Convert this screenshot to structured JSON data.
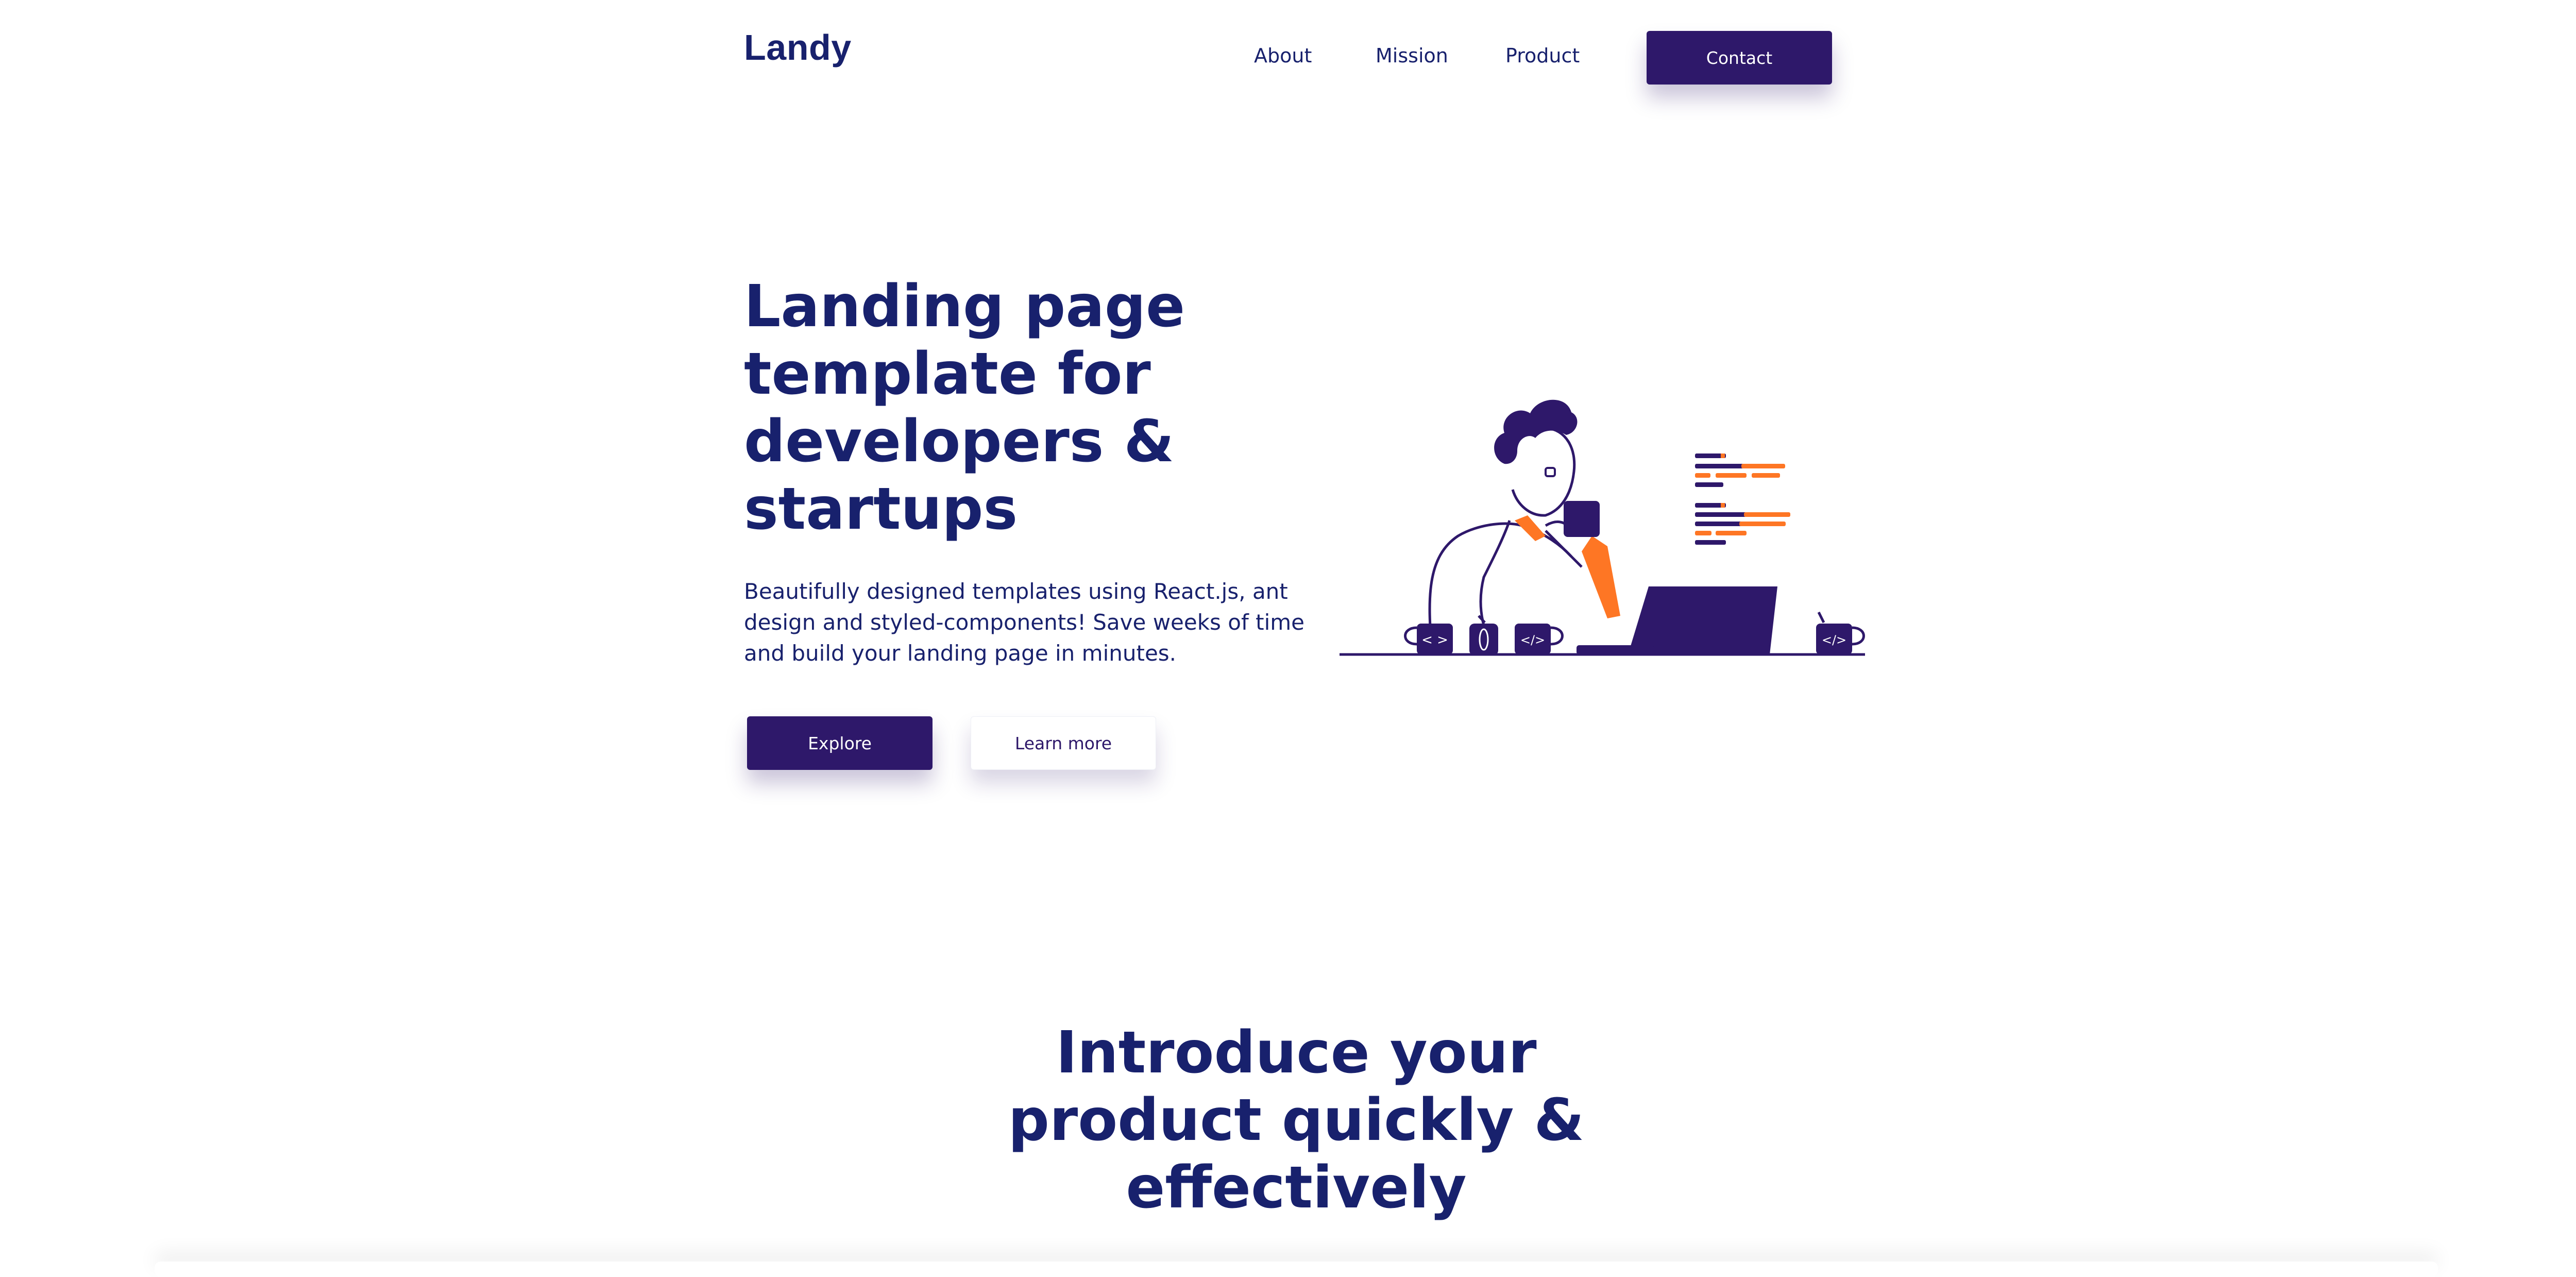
{
  "header": {
    "logo": "Landy",
    "nav": [
      "About",
      "Mission",
      "Product"
    ],
    "contact_label": "Contact"
  },
  "hero": {
    "title_lines": [
      "Landing page",
      "template for",
      "developers &",
      "startups"
    ],
    "text_lines": [
      "Beautifully designed templates using React.js, ant",
      "design and styled-components! Save weeks of time",
      "and build your landing page in minutes."
    ],
    "primary_label": "Explore",
    "secondary_label": "Learn more"
  },
  "illustration": {
    "name": "developer-at-laptop",
    "mug_left_glyph": "< >",
    "mug_middle_glyph": "</>",
    "mug_right_glyph": "</>",
    "colors": {
      "primary": "#2e186a",
      "accent": "#fe7624",
      "text": "#18216d"
    }
  },
  "intro": {
    "title_lines": [
      "Introduce your",
      "product quickly &",
      "effectively"
    ]
  }
}
